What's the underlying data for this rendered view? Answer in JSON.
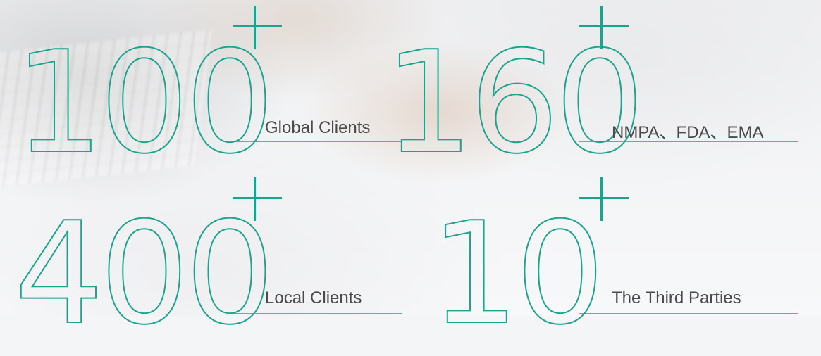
{
  "stats": [
    {
      "value": "100",
      "label": "Global Clients"
    },
    {
      "value": "160",
      "label": "NMPA、FDA、EMA"
    },
    {
      "value": "400",
      "label": "Local Clients"
    },
    {
      "value": "10",
      "label": "The Third Parties"
    }
  ],
  "colors": {
    "accent": "#1aa38d",
    "label_text": "#4a4a4a",
    "background": "#f4f5f6"
  },
  "icons": [
    "plus-icon",
    "plus-icon",
    "plus-icon",
    "plus-icon"
  ]
}
